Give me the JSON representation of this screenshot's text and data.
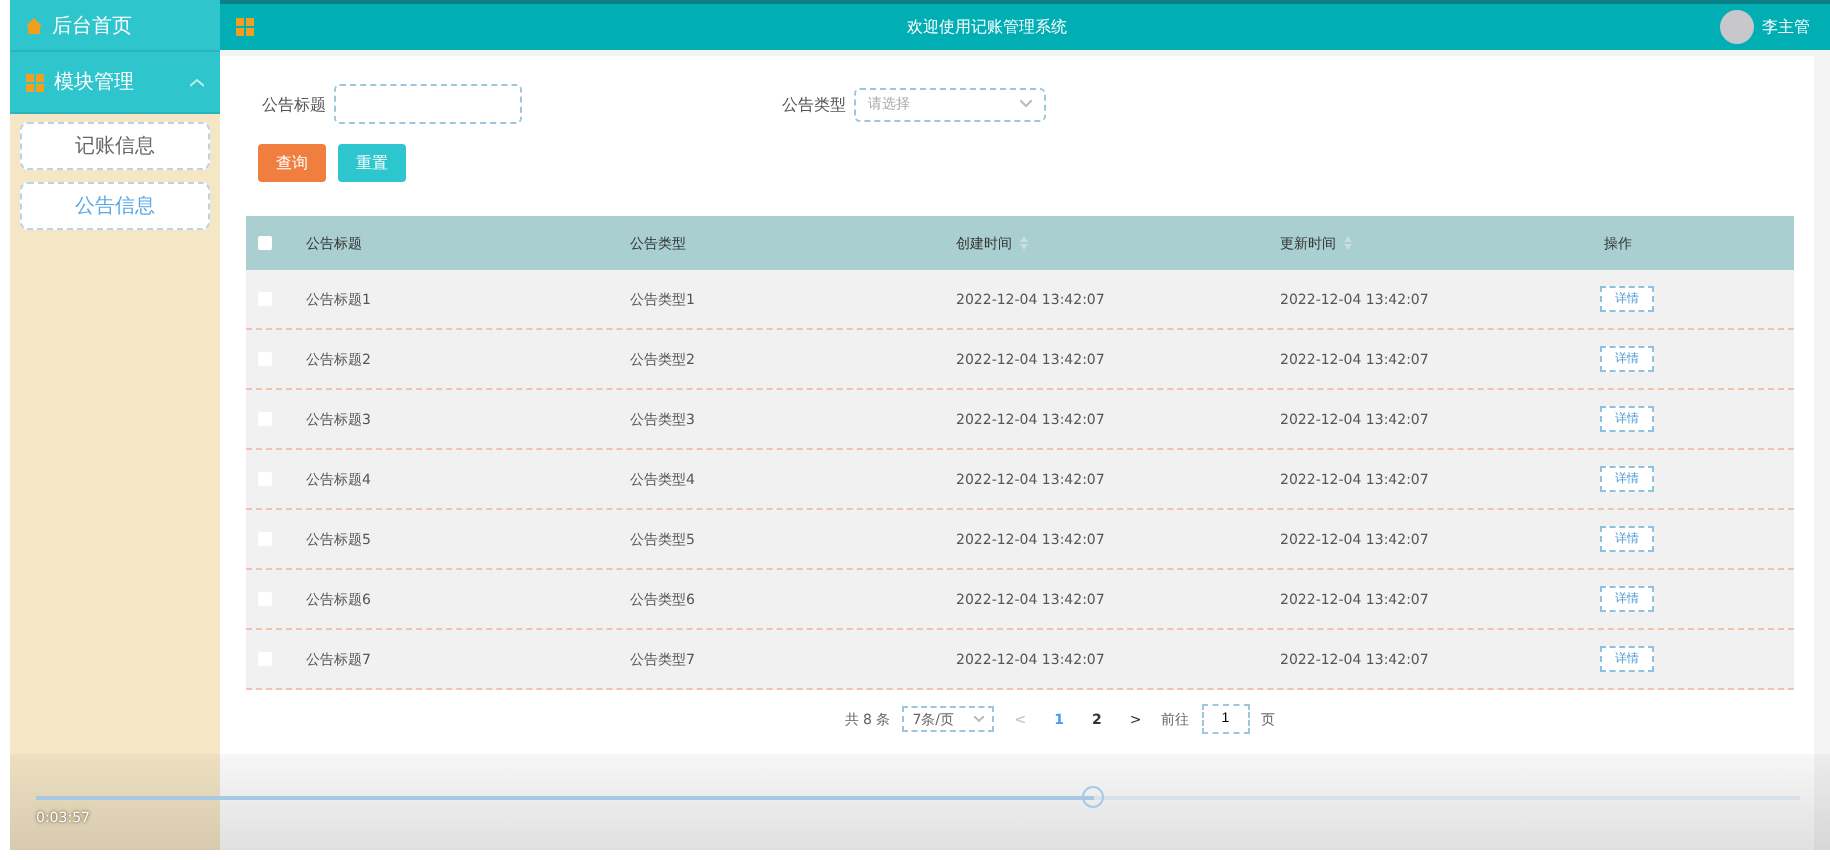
{
  "sidebar": {
    "items": [
      {
        "label": "后台首页",
        "kind": "home"
      },
      {
        "label": "模块管理",
        "kind": "group",
        "expanded": true,
        "children": [
          {
            "label": "记账信息",
            "selected": false
          },
          {
            "label": "公告信息",
            "selected": true
          }
        ]
      }
    ]
  },
  "topbar": {
    "title": "欢迎使用记账管理系统",
    "user": "李主管"
  },
  "search": {
    "fields": [
      {
        "label": "公告标题",
        "kind": "input"
      },
      {
        "label": "公告类型",
        "kind": "select",
        "placeholder": "请选择"
      }
    ],
    "buttons": [
      {
        "label": "查询",
        "kind": "primary"
      },
      {
        "label": "重置",
        "kind": "secondary"
      }
    ]
  },
  "table": {
    "select_all": {
      "checked": false
    },
    "columns": [
      {
        "label": "公告标题",
        "sortable": false
      },
      {
        "label": "公告类型",
        "sortable": false
      },
      {
        "label": "创建时间",
        "sortable": true
      },
      {
        "label": "更新时间",
        "sortable": true
      },
      {
        "label": "操作",
        "sortable": false
      }
    ],
    "rows": [
      {
        "checked": false,
        "cells": [
          "公告标题1",
          "公告类型1",
          "2022-12-04 13:42:07",
          "2022-12-04 13:42:07"
        ],
        "action": "详情"
      },
      {
        "checked": false,
        "cells": [
          "公告标题2",
          "公告类型2",
          "2022-12-04 13:42:07",
          "2022-12-04 13:42:07"
        ],
        "action": "详情"
      },
      {
        "checked": false,
        "cells": [
          "公告标题3",
          "公告类型3",
          "2022-12-04 13:42:07",
          "2022-12-04 13:42:07"
        ],
        "action": "详情"
      },
      {
        "checked": false,
        "cells": [
          "公告标题4",
          "公告类型4",
          "2022-12-04 13:42:07",
          "2022-12-04 13:42:07"
        ],
        "action": "详情"
      },
      {
        "checked": false,
        "cells": [
          "公告标题5",
          "公告类型5",
          "2022-12-04 13:42:07",
          "2022-12-04 13:42:07"
        ],
        "action": "详情"
      },
      {
        "checked": false,
        "cells": [
          "公告标题6",
          "公告类型6",
          "2022-12-04 13:42:07",
          "2022-12-04 13:42:07"
        ],
        "action": "详情"
      },
      {
        "checked": false,
        "cells": [
          "公告标题7",
          "公告类型7",
          "2022-12-04 13:42:07",
          "2022-12-04 13:42:07"
        ],
        "action": "详情"
      }
    ]
  },
  "pagination": {
    "total": "共 8 条",
    "page_size": "7条/页",
    "prev": "<",
    "pages": [
      {
        "label": "1",
        "selected": true
      },
      {
        "label": "2",
        "selected": false
      }
    ],
    "next": ">",
    "goto": "前往",
    "goto_value": "1",
    "goto_unit": "页"
  },
  "player": {
    "time": "0:03:57",
    "level": 0.6
  }
}
